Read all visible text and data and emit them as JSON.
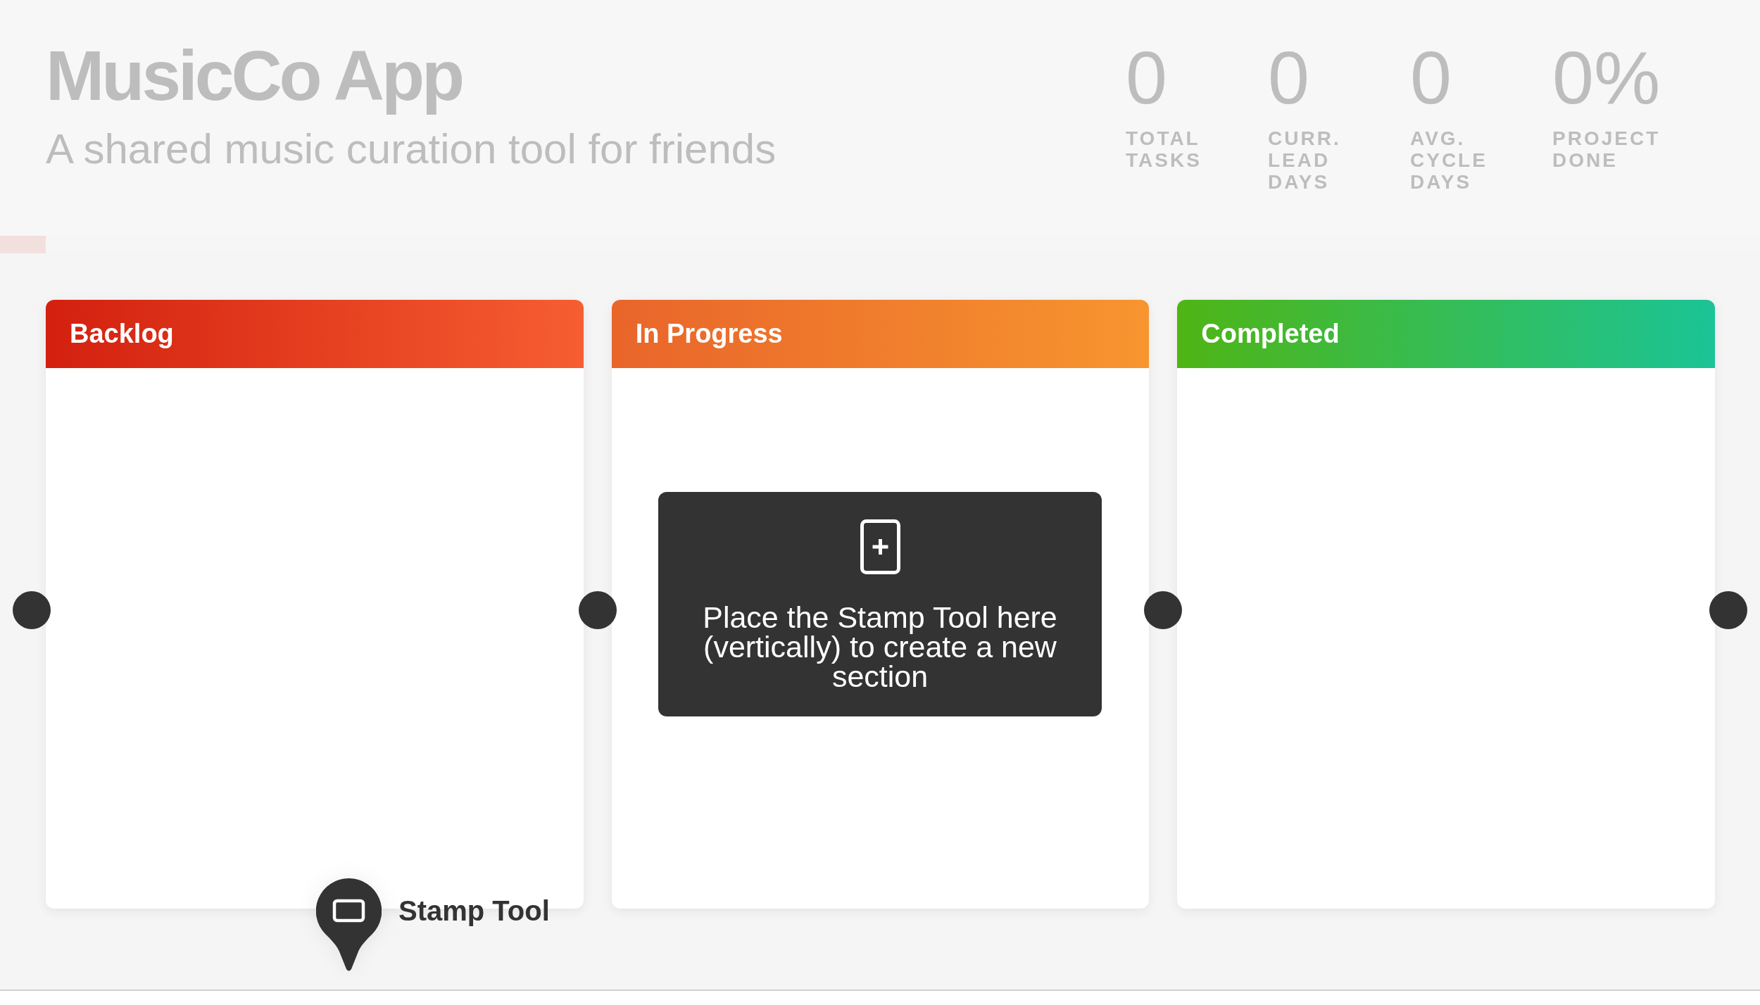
{
  "header": {
    "title": "MusicCo App",
    "subtitle": "A shared music curation tool for friends"
  },
  "stats": [
    {
      "value": "0",
      "label": "TOTAL TASKS"
    },
    {
      "value": "0",
      "label": "CURR. LEAD DAYS"
    },
    {
      "value": "0",
      "label": "AVG. CYCLE DAYS"
    },
    {
      "value": "0%",
      "label": "PROJECT DONE"
    }
  ],
  "columns": [
    {
      "title": "Backlog",
      "gradient": [
        {
          "color": "#d3200f"
        },
        {
          "color": "#f65e31"
        }
      ]
    },
    {
      "title": "In Progress",
      "gradient": [
        {
          "color": "#e9652a"
        },
        {
          "color": "#f7952f"
        }
      ]
    },
    {
      "title": "Completed",
      "gradient": [
        {
          "color": "#4fb515"
        },
        {
          "color": "#1bc496"
        }
      ]
    }
  ],
  "tooltip": {
    "text": "Place the Stamp Tool here (vertically) to create a new section"
  },
  "stamp_tool": {
    "label": "Stamp Tool"
  }
}
